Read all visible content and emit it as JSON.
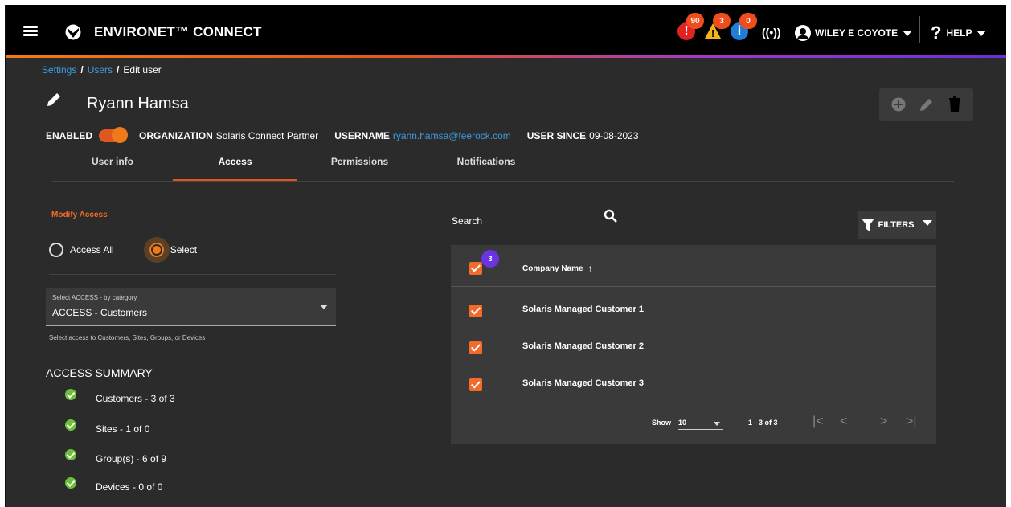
{
  "app": {
    "title": "ENVIRONET™ CONNECT",
    "alerts": [
      {
        "name": "critical",
        "count": "90",
        "color": "#e02424",
        "glyph": "!"
      },
      {
        "name": "warning",
        "count": "3",
        "color": "#f2b51a",
        "glyph": "!"
      },
      {
        "name": "info",
        "count": "0",
        "color": "#1f7fd6",
        "glyph": "i"
      }
    ],
    "signal_icon": "((•))",
    "user": "WILEY E COYOTE",
    "help": "HELP",
    "help_glyph": "?"
  },
  "breadcrumb": {
    "settings": "Settings",
    "users": "Users",
    "current": "Edit user",
    "sep": "/"
  },
  "user": {
    "name": "Ryann Hamsa",
    "enabled_label": "ENABLED",
    "org_label": "ORGANIZATION",
    "org_value": "Solaris Connect Partner",
    "username_label": "USERNAME",
    "username_value": "ryann.hamsa@feerock.com",
    "since_label": "USER SINCE",
    "since_value": "09-08-2023"
  },
  "tabs": [
    "User info",
    "Access",
    "Permissions",
    "Notifications"
  ],
  "access": {
    "modify_label": "Modify Access",
    "radio_all": "Access All",
    "radio_select": "Select",
    "select_caption": "Select ACCESS - by category",
    "select_value": "ACCESS - Customers",
    "select_help": "Select access to Customers, Sites, Groups, or Devices",
    "summary_title": "ACCESS SUMMARY",
    "summary": [
      "Customers - 3 of 3",
      "Sites - 1 of 0",
      "Group(s) - 6 of 9",
      "Devices - 0 of 0"
    ]
  },
  "table": {
    "search_placeholder": "Search",
    "filters_label": "FILTERS",
    "selected_count": "3",
    "column": "Company Name",
    "sort_arrow": "↑",
    "rows": [
      "Solaris Managed Customer 1",
      "Solaris Managed Customer 2",
      "Solaris Managed Customer 3"
    ],
    "show_label": "Show",
    "per_page": "10",
    "range": "1 - 3 of 3",
    "nav": {
      "first": "|<",
      "prev": "<",
      "next": ">",
      "last": ">|"
    }
  }
}
